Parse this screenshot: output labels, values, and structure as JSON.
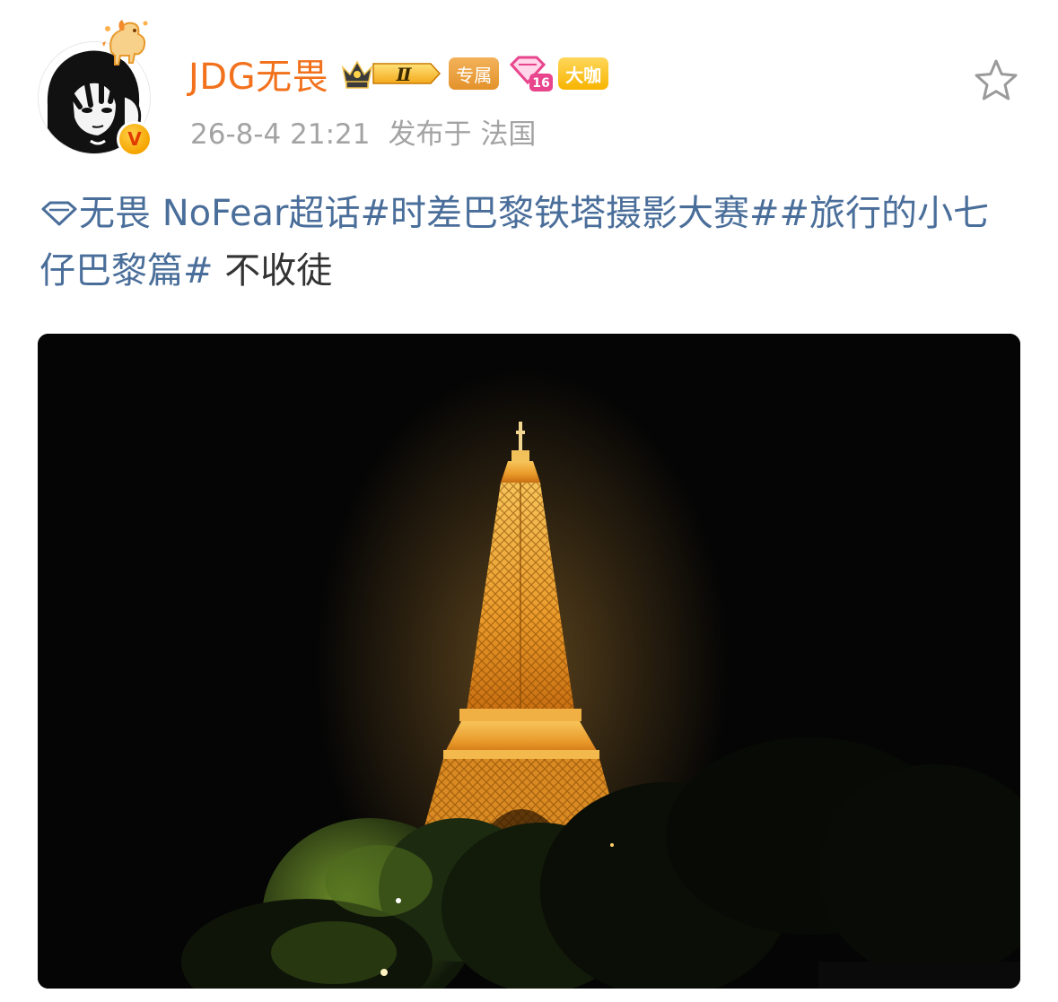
{
  "user": {
    "name": "JDG无畏",
    "level_badge_text": "Ⅱ",
    "tags": {
      "exclusive": "专属",
      "fan_level": "16",
      "daka": "大咖"
    },
    "verified_text": "V"
  },
  "post": {
    "timestamp": "26-8-4 21:21",
    "location_prefix": "发布于",
    "location": "法国",
    "supertopic": "无畏 NoFear超话",
    "hashtag_1": "#时差巴黎铁塔摄影大赛#",
    "hashtag_2": "#旅行的小七仔巴黎篇#",
    "text": "不收徒"
  },
  "icons": {
    "star": "star-outline-icon",
    "topic": "diamond-topic-icon",
    "verified": "orange-v-verified-icon"
  },
  "colors": {
    "username": "#f2711c",
    "link": "#4a6e9a",
    "meta": "#a3a3a3",
    "body_text": "#333333",
    "photo_background": "#050505",
    "tower_light": "#f0a632"
  }
}
